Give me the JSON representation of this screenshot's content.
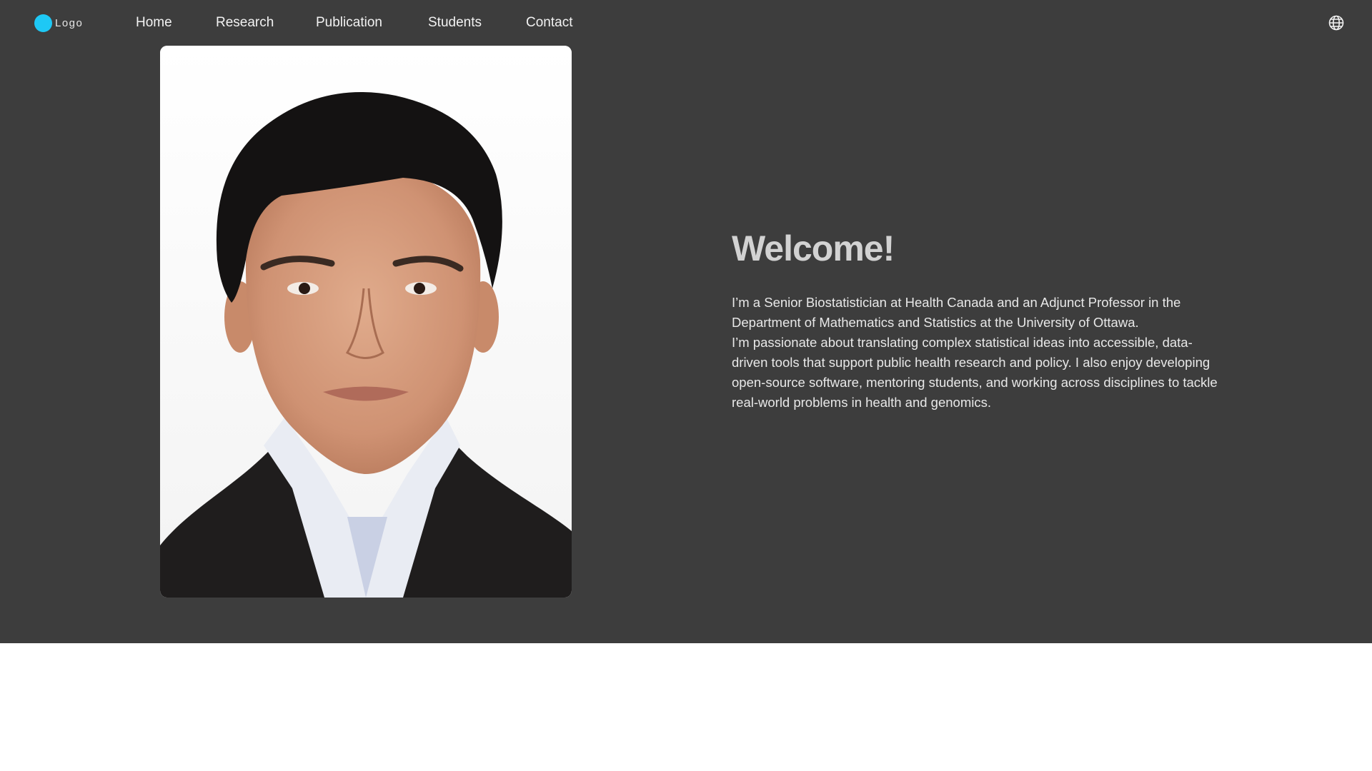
{
  "logo": {
    "text": "Logo",
    "dot_color": "#1ec8f5"
  },
  "nav": {
    "items": [
      {
        "label": "Home"
      },
      {
        "label": "Research"
      },
      {
        "label": "Publication"
      },
      {
        "label": "Students"
      },
      {
        "label": "Contact"
      }
    ],
    "language_icon": "globe-icon"
  },
  "hero": {
    "background": "#3d3d3d",
    "title": "Welcome!",
    "bio": [
      "I’m a Senior Biostatistician at Health Canada and an Adjunct Professor in the Department of Mathematics and Statistics at the University of Ottawa.",
      "I’m passionate about translating complex statistical ideas into accessible, data-driven tools that support public health research and policy. I also enjoy developing open-source software, mentoring students, and working across disciplines to tackle real-world problems in health and genomics."
    ]
  }
}
